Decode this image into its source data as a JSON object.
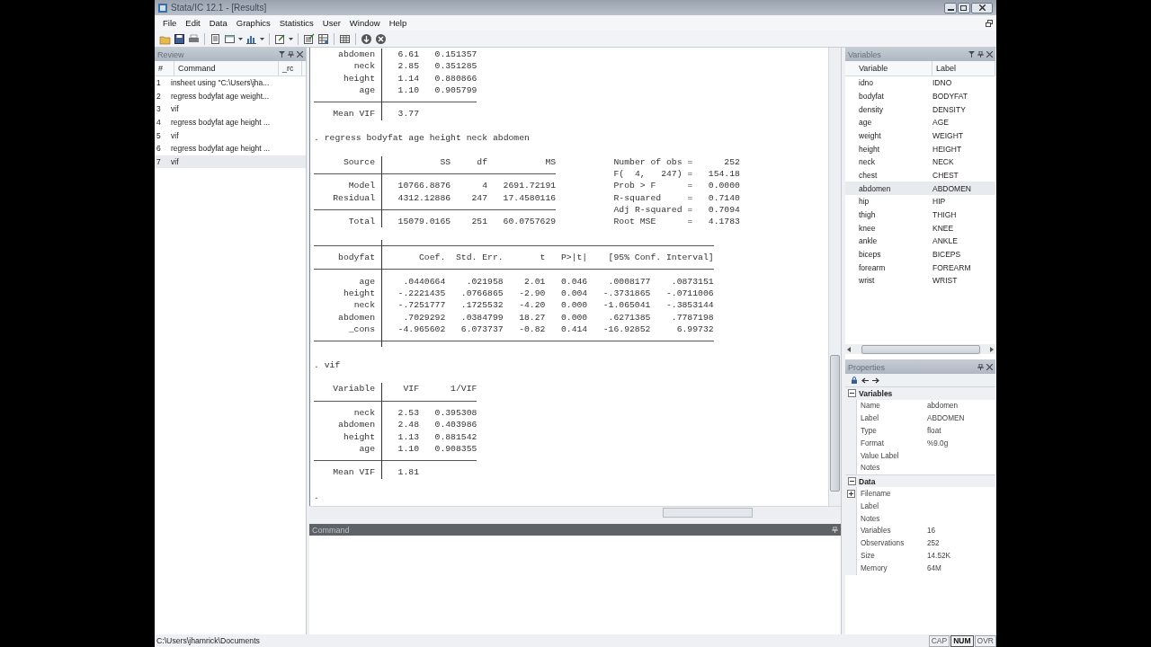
{
  "window": {
    "title": "Stata/IC 12.1 - [Results]"
  },
  "menu": [
    "File",
    "Edit",
    "Data",
    "Graphics",
    "Statistics",
    "User",
    "Window",
    "Help"
  ],
  "review": {
    "title": "Review",
    "columns": [
      "#",
      "Command",
      "_rc"
    ],
    "rows": [
      {
        "number": "1",
        "command": "insheet using \"C:\\Users\\jha...",
        "selected": false
      },
      {
        "number": "2",
        "command": "regress bodyfat age weight...",
        "selected": false
      },
      {
        "number": "3",
        "command": "vif",
        "selected": false
      },
      {
        "number": "4",
        "command": "regress bodyfat age height ...",
        "selected": false
      },
      {
        "number": "5",
        "command": "vif",
        "selected": false
      },
      {
        "number": "6",
        "command": "regress bodyfat age height ...",
        "selected": false
      },
      {
        "number": "7",
        "command": "vif",
        "selected": true
      }
    ]
  },
  "results": {
    "blocks": [
      {
        "kind": "table",
        "top_rule": false,
        "bottom_rule": false,
        "groups": [
          [
            [
              "abdomen",
              "6.61",
              "0.151357"
            ],
            [
              "neck",
              "2.85",
              "0.351285"
            ],
            [
              "height",
              "1.14",
              "0.880866"
            ],
            [
              "age",
              "1.10",
              "0.905799"
            ]
          ],
          [
            [
              "Mean VIF",
              "3.77"
            ]
          ]
        ]
      },
      {
        "kind": "command",
        "text": ". regress bodyfat age height neck abdomen"
      },
      {
        "kind": "table",
        "top_rule": false,
        "bottom_rule": false,
        "header": [
          "Source",
          "SS",
          "df",
          "MS"
        ],
        "groups": [
          [
            [
              "Model",
              "10766.8876",
              "4",
              "2691.72191"
            ],
            [
              "Residual",
              "4312.12886",
              "247",
              "17.4580116"
            ]
          ],
          [
            [
              "Total",
              "15079.0165",
              "251",
              "60.0757629"
            ]
          ]
        ],
        "side": [
          "Number of obs =      252",
          "F(  4,   247) =   154.18",
          "Prob > F      =   0.0000",
          "R-squared     =   0.7140",
          "Adj R-squared =   0.7094",
          "Root MSE      =   4.1783"
        ]
      },
      {
        "kind": "table",
        "top_rule": true,
        "bottom_rule": true,
        "header": [
          "bodyfat",
          "Coef.",
          "Std. Err.",
          "t",
          "P>|t|",
          "[95% Conf. Interval]"
        ],
        "groups": [
          [
            [
              "age",
              ".0440664",
              ".021958",
              "2.01",
              "0.046",
              ".0008177",
              ".0873151"
            ],
            [
              "height",
              "-.2221435",
              ".0766865",
              "-2.90",
              "0.004",
              "-.3731865",
              "-.0711006"
            ],
            [
              "neck",
              "-.7251777",
              ".1725532",
              "-4.20",
              "0.000",
              "-1.065041",
              "-.3853144"
            ],
            [
              "abdomen",
              ".7029292",
              ".0384799",
              "18.27",
              "0.000",
              ".6271385",
              ".7787198"
            ],
            [
              "_cons",
              "-4.965602",
              "6.073737",
              "-0.82",
              "0.414",
              "-16.92852",
              "6.99732"
            ]
          ]
        ]
      },
      {
        "kind": "command",
        "text": ". vif"
      },
      {
        "kind": "table",
        "top_rule": false,
        "bottom_rule": false,
        "header": [
          "Variable",
          "VIF",
          "1/VIF"
        ],
        "groups": [
          [
            [
              "neck",
              "2.53",
              "0.395308"
            ],
            [
              "abdomen",
              "2.48",
              "0.403986"
            ],
            [
              "height",
              "1.13",
              "0.881542"
            ],
            [
              "age",
              "1.10",
              "0.908355"
            ]
          ],
          [
            [
              "Mean VIF",
              "1.81"
            ]
          ]
        ]
      },
      {
        "kind": "command",
        "text": "."
      }
    ]
  },
  "command_pane": {
    "title": "Command"
  },
  "variables": {
    "title": "Variables",
    "columns": [
      "Variable",
      "Label"
    ],
    "rows": [
      {
        "name": "idno",
        "label": "IDNO",
        "selected": false
      },
      {
        "name": "bodyfat",
        "label": "BODYFAT",
        "selected": false
      },
      {
        "name": "density",
        "label": "DENSITY",
        "selected": false
      },
      {
        "name": "age",
        "label": "AGE",
        "selected": false
      },
      {
        "name": "weight",
        "label": "WEIGHT",
        "selected": false
      },
      {
        "name": "height",
        "label": "HEIGHT",
        "selected": false
      },
      {
        "name": "neck",
        "label": "NECK",
        "selected": false
      },
      {
        "name": "chest",
        "label": "CHEST",
        "selected": false
      },
      {
        "name": "abdomen",
        "label": "ABDOMEN",
        "selected": true
      },
      {
        "name": "hip",
        "label": "HIP",
        "selected": false
      },
      {
        "name": "thigh",
        "label": "THIGH",
        "selected": false
      },
      {
        "name": "knee",
        "label": "KNEE",
        "selected": false
      },
      {
        "name": "ankle",
        "label": "ANKLE",
        "selected": false
      },
      {
        "name": "biceps",
        "label": "BICEPS",
        "selected": false
      },
      {
        "name": "forearm",
        "label": "FOREARM",
        "selected": false
      },
      {
        "name": "wrist",
        "label": "WRIST",
        "selected": false
      }
    ]
  },
  "properties": {
    "title": "Properties",
    "sections": [
      {
        "title": "Variables",
        "expanded": true,
        "rows": [
          {
            "name": "Name",
            "value": "abdomen",
            "expandable": false
          },
          {
            "name": "Label",
            "value": "ABDOMEN",
            "expandable": false
          },
          {
            "name": "Type",
            "value": "float",
            "expandable": false
          },
          {
            "name": "Format",
            "value": "%9.0g",
            "expandable": false
          },
          {
            "name": "Value Label",
            "expandable": false
          },
          {
            "name": "Notes",
            "expandable": false
          }
        ]
      },
      {
        "title": "Data",
        "expanded": true,
        "rows": [
          {
            "name": "Filename",
            "expandable": true
          },
          {
            "name": "Label",
            "expandable": false
          },
          {
            "name": "Notes",
            "expandable": false
          },
          {
            "name": "Variables",
            "value": "16",
            "expandable": false
          },
          {
            "name": "Observations",
            "value": "252",
            "expandable": false
          },
          {
            "name": "Size",
            "value": "14.52K",
            "expandable": false
          },
          {
            "name": "Memory",
            "value": "64M",
            "expandable": false
          }
        ]
      }
    ]
  },
  "status_bar": {
    "path": "C:\\Users\\jhamrick\\Documents",
    "indicators": [
      {
        "label": "CAP",
        "on": false
      },
      {
        "label": "NUM",
        "on": true
      },
      {
        "label": "OVR",
        "on": false
      }
    ]
  }
}
